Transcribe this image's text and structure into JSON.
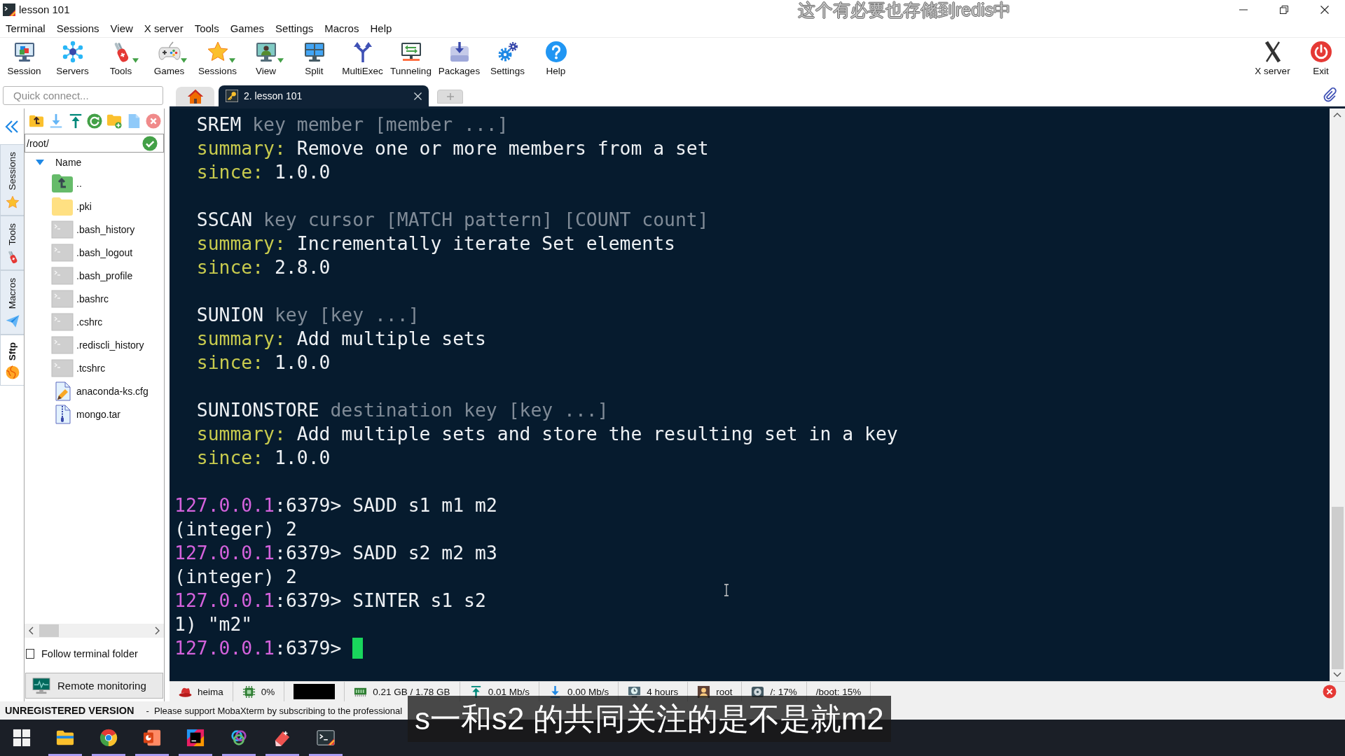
{
  "window": {
    "title": "lesson 101"
  },
  "subtitles": {
    "upper": "这个有必要也存储到redis中",
    "lower": "s一和s2 的共同关注的是不是就m2"
  },
  "menu": [
    "Terminal",
    "Sessions",
    "View",
    "X server",
    "Tools",
    "Games",
    "Settings",
    "Macros",
    "Help"
  ],
  "toolbar": [
    {
      "kind": "session",
      "label": "Session",
      "dropdown": false
    },
    {
      "kind": "servers",
      "label": "Servers",
      "dropdown": false
    },
    {
      "kind": "tools",
      "label": "Tools",
      "dropdown": true
    },
    {
      "kind": "games",
      "label": "Games",
      "dropdown": true
    },
    {
      "kind": "sessions",
      "label": "Sessions",
      "dropdown": true
    },
    {
      "kind": "view",
      "label": "View",
      "dropdown": true
    },
    {
      "kind": "split",
      "label": "Split",
      "dropdown": false
    },
    {
      "kind": "multiexec",
      "label": "MultiExec",
      "dropdown": false
    },
    {
      "kind": "tunneling",
      "label": "Tunneling",
      "dropdown": false
    },
    {
      "kind": "packages",
      "label": "Packages",
      "dropdown": false
    },
    {
      "kind": "settings",
      "label": "Settings",
      "dropdown": false
    },
    {
      "kind": "help",
      "label": "Help",
      "dropdown": false
    }
  ],
  "toolbar_right": [
    {
      "kind": "xserver",
      "label": "X server"
    },
    {
      "kind": "exit",
      "label": "Exit"
    }
  ],
  "quick_connect": {
    "placeholder": "Quick connect..."
  },
  "tabs": [
    {
      "kind": "home",
      "selected": false
    },
    {
      "kind": "session",
      "label": "2. lesson 101",
      "selected": true
    }
  ],
  "sidebar": {
    "tabs": [
      {
        "kind": "sessions",
        "label": "Sessions",
        "selected": false
      },
      {
        "kind": "tools",
        "label": "Tools",
        "selected": false
      },
      {
        "kind": "macros",
        "label": "Macros",
        "selected": false
      },
      {
        "kind": "sftp",
        "label": "Sftp",
        "selected": true
      }
    ],
    "sftp": {
      "path": "/root/",
      "column": "Name",
      "files": [
        {
          "kind": "parent",
          "name": ".."
        },
        {
          "kind": "folder",
          "name": ".pki"
        },
        {
          "kind": "shell",
          "name": ".bash_history"
        },
        {
          "kind": "shell",
          "name": ".bash_logout"
        },
        {
          "kind": "shell",
          "name": ".bash_profile"
        },
        {
          "kind": "shell",
          "name": ".bashrc"
        },
        {
          "kind": "shell",
          "name": ".cshrc"
        },
        {
          "kind": "shell",
          "name": ".rediscli_history"
        },
        {
          "kind": "shell",
          "name": ".tcshrc"
        },
        {
          "kind": "config",
          "name": "anaconda-ks.cfg"
        },
        {
          "kind": "archive",
          "name": "mongo.tar"
        }
      ],
      "follow_terminal_folder": {
        "label": "Follow terminal folder",
        "checked": false
      },
      "remote_monitoring": "Remote monitoring"
    }
  },
  "terminal": {
    "help_entries": [
      {
        "command": "SREM",
        "args": "key member [member ...]",
        "summary_label": "summary:",
        "summary": "Remove one or more members from a set",
        "since_label": "since:",
        "since": "1.0.0"
      },
      {
        "command": "SSCAN",
        "args": "key cursor [MATCH pattern] [COUNT count]",
        "summary_label": "summary:",
        "summary": "Incrementally iterate Set elements",
        "since_label": "since:",
        "since": "2.8.0"
      },
      {
        "command": "SUNION",
        "args": "key [key ...]",
        "summary_label": "summary:",
        "summary": "Add multiple sets",
        "since_label": "since:",
        "since": "1.0.0"
      },
      {
        "command": "SUNIONSTORE",
        "args": "destination key [key ...]",
        "summary_label": "summary:",
        "summary": "Add multiple sets and store the resulting set in a key",
        "since_label": "since:",
        "since": "1.0.0"
      }
    ],
    "session_lines": [
      {
        "kind": "prompt",
        "host": "127.0.0.1",
        "port": ":6379>",
        "command": "SADD s1 m1 m2",
        "cursor": false
      },
      {
        "kind": "output",
        "text": "(integer) 2",
        "cursor": false
      },
      {
        "kind": "prompt",
        "host": "127.0.0.1",
        "port": ":6379>",
        "command": "SADD s2 m2 m3",
        "cursor": false
      },
      {
        "kind": "output",
        "text": "(integer) 2",
        "cursor": false
      },
      {
        "kind": "prompt",
        "host": "127.0.0.1",
        "port": ":6379>",
        "command": "SINTER s1 s2",
        "cursor": false
      },
      {
        "kind": "output",
        "text": "1) \"m2\"",
        "cursor": false
      },
      {
        "kind": "prompt",
        "host": "127.0.0.1",
        "port": ":6379>",
        "cursor": true
      }
    ]
  },
  "status_bar": [
    {
      "kind": "user",
      "text": "heima"
    },
    {
      "kind": "cpu",
      "text": "0%"
    },
    {
      "kind": "graph"
    },
    {
      "kind": "memory",
      "text": "0.21 GB / 1.78 GB"
    },
    {
      "kind": "upload",
      "text": "0.01 Mb/s"
    },
    {
      "kind": "download",
      "text": "0.00 Mb/s"
    },
    {
      "kind": "uptime",
      "text": "4 hours"
    },
    {
      "kind": "account",
      "text": "root"
    },
    {
      "kind": "disk",
      "text": "/: 17%"
    },
    {
      "kind": "partition",
      "text": "/boot: 15%"
    }
  ],
  "notice": {
    "label": "UNREGISTERED VERSION",
    "text": "-  Please support MobaXterm by subscribing to the professional"
  },
  "taskbar": [
    {
      "kind": "start",
      "running": false
    },
    {
      "kind": "explorer",
      "running": true
    },
    {
      "kind": "browser",
      "running": true
    },
    {
      "kind": "slides",
      "running": true
    },
    {
      "kind": "ide",
      "running": true
    },
    {
      "kind": "rings",
      "running": true
    },
    {
      "kind": "eraser",
      "running": true
    },
    {
      "kind": "terminal",
      "running": true
    }
  ]
}
